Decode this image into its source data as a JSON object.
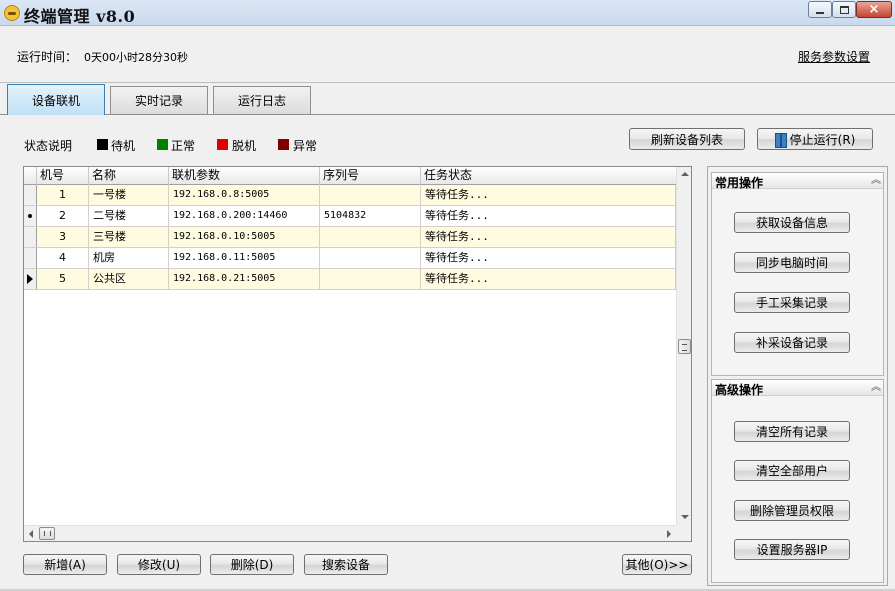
{
  "window": {
    "title": "终端管理 v8.0",
    "controls": {
      "minimize": "minimize",
      "maximize": "maximize",
      "close": "×"
    }
  },
  "status": {
    "runtime_label": "运行时间：",
    "runtime_value": "0天00小时28分30秒",
    "service_settings": "服务参数设置"
  },
  "tabs": [
    {
      "label": "设备联机",
      "active": true
    },
    {
      "label": "实时记录",
      "active": false
    },
    {
      "label": "运行日志",
      "active": false
    }
  ],
  "legend": {
    "title": "状态说明",
    "items": [
      {
        "label": "待机",
        "color": "#000000"
      },
      {
        "label": "正常",
        "color": "#008000"
      },
      {
        "label": "脱机",
        "color": "#e00000"
      },
      {
        "label": "异常",
        "color": "#800000"
      }
    ]
  },
  "toolbar": {
    "refresh": "刷新设备列表",
    "stop": "停止运行(R)"
  },
  "grid": {
    "columns": [
      "机号",
      "名称",
      "联机参数",
      "序列号",
      "任务状态"
    ],
    "rows": [
      {
        "indicator": "",
        "id": "1",
        "name": "一号楼",
        "params": "192.168.0.8:5005",
        "serial": "",
        "status": "等待任务..."
      },
      {
        "indicator": "dot",
        "id": "2",
        "name": "二号楼",
        "params": "192.168.0.200:14460",
        "serial": "5104832",
        "status": "等待任务..."
      },
      {
        "indicator": "",
        "id": "3",
        "name": "三号楼",
        "params": "192.168.0.10:5005",
        "serial": "",
        "status": "等待任务..."
      },
      {
        "indicator": "",
        "id": "4",
        "name": "机房",
        "params": "192.168.0.11:5005",
        "serial": "",
        "status": "等待任务..."
      },
      {
        "indicator": "arrow",
        "id": "5",
        "name": "公共区",
        "params": "192.168.0.21:5005",
        "serial": "",
        "status": "等待任务..."
      }
    ]
  },
  "bottom_buttons": {
    "add": "新增(A)",
    "edit": "修改(U)",
    "delete": "删除(D)",
    "search": "搜索设备",
    "other": "其他(O)>>"
  },
  "right_panel": {
    "common": {
      "title": "常用操作",
      "buttons": [
        "获取设备信息",
        "同步电脑时间",
        "手工采集记录",
        "补采设备记录"
      ]
    },
    "advanced": {
      "title": "高级操作",
      "buttons": [
        "清空所有记录",
        "清空全部用户",
        "删除管理员权限",
        "设置服务器IP"
      ]
    }
  }
}
